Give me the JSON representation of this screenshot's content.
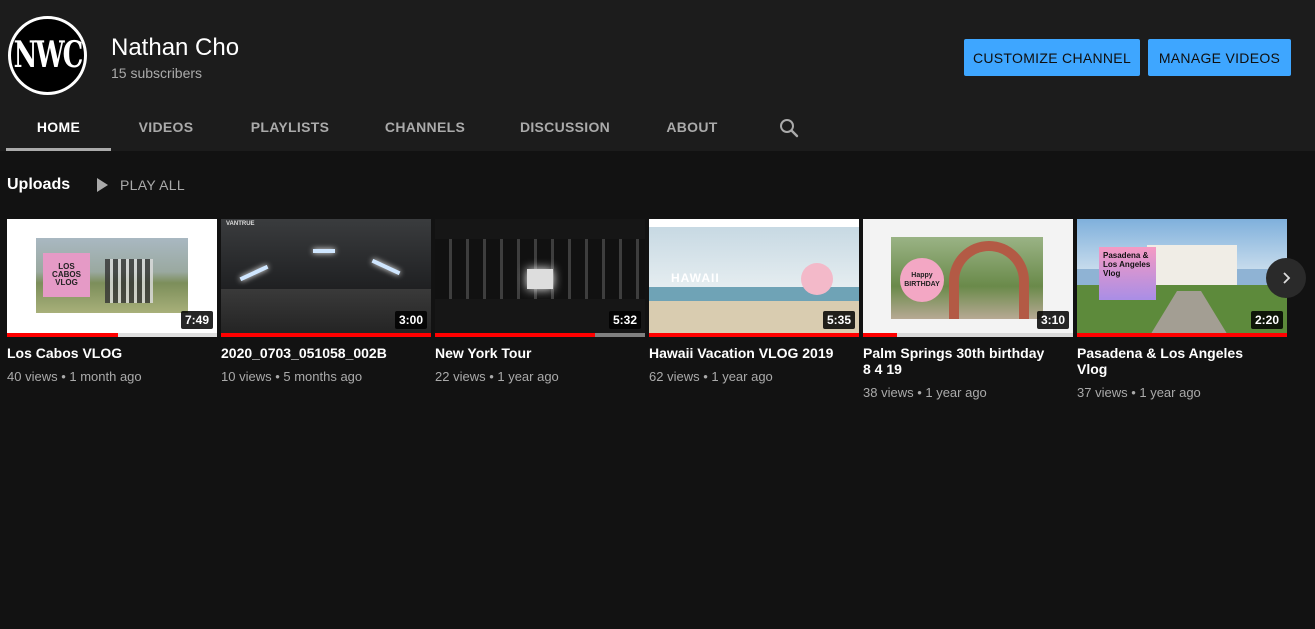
{
  "channel": {
    "avatar_text": "NWC",
    "name": "Nathan Cho",
    "subscribers": "15 subscribers"
  },
  "buttons": {
    "customize": "CUSTOMIZE CHANNEL",
    "manage": "MANAGE VIDEOS"
  },
  "tabs": [
    "HOME",
    "VIDEOS",
    "PLAYLISTS",
    "CHANNELS",
    "DISCUSSION",
    "ABOUT"
  ],
  "active_tab": "HOME",
  "shelf": {
    "title": "Uploads",
    "play_all": "PLAY ALL"
  },
  "videos": [
    {
      "title": "Los Cabos VLOG",
      "meta": "40 views • 1 month ago",
      "duration": "7:49",
      "progress": 0.53,
      "thumb_text": "LOS CABOS VLOG"
    },
    {
      "title": "2020_0703_051058_002B",
      "meta": "10 views • 5 months ago",
      "duration": "3:00",
      "progress": 1.0,
      "thumb_text": "VANTRUE"
    },
    {
      "title": "New York Tour",
      "meta": "22 views • 1 year ago",
      "duration": "5:32",
      "progress": 0.76,
      "thumb_text": ""
    },
    {
      "title": "Hawaii Vacation VLOG 2019",
      "meta": "62 views • 1 year ago",
      "duration": "5:35",
      "progress": 1.0,
      "thumb_text": "HAWAII"
    },
    {
      "title": "Palm Springs 30th birthday 8 4 19",
      "meta": "38 views • 1 year ago",
      "duration": "3:10",
      "progress": 0.16,
      "thumb_text": "Happy BIRTHDAY"
    },
    {
      "title": "Pasadena & Los Angeles Vlog",
      "meta": "37 views • 1 year ago",
      "duration": "2:20",
      "progress": 1.0,
      "thumb_text": "Pasadena & Los Angeles Vlog"
    }
  ],
  "colors": {
    "accent_button": "#3ea6ff",
    "progress": "#ff0000",
    "background": "#121212",
    "header": "#1c1c1c"
  }
}
